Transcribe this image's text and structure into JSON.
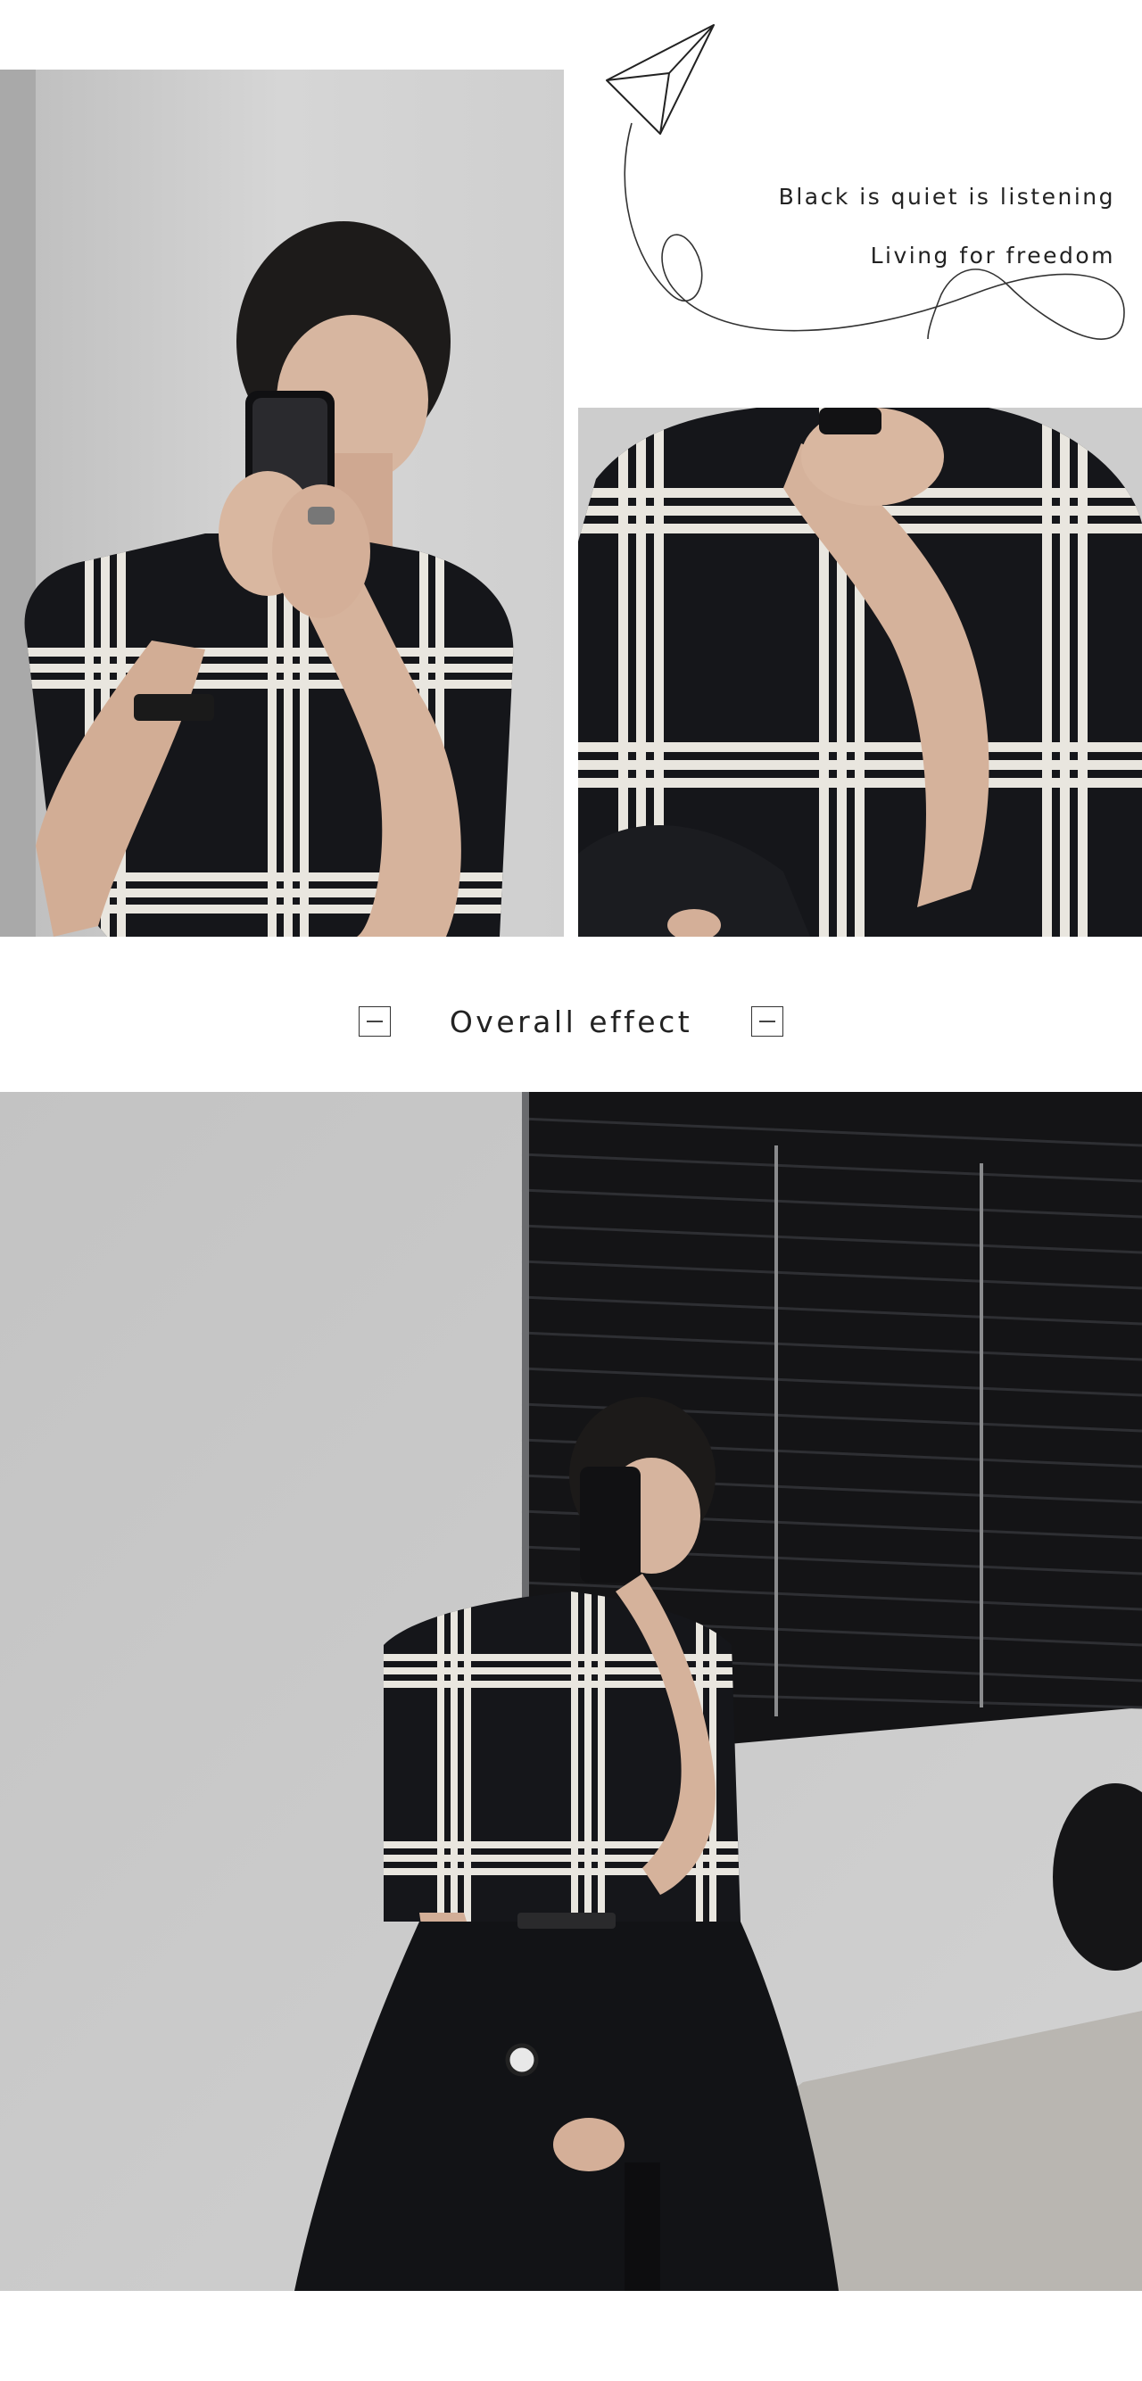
{
  "header": {
    "tagline_1": "Black is quiet is listening",
    "tagline_2": "Living for freedom"
  },
  "section": {
    "title": "Overall effect"
  },
  "icons": {
    "decoration": "paper-plane-icon",
    "section_marks": "minus-box-icon"
  },
  "colors": {
    "background": "#ffffff",
    "shirt": "#15161a",
    "stripe": "#e9e6df",
    "wall": "#c8c8c8",
    "text": "#222222"
  }
}
